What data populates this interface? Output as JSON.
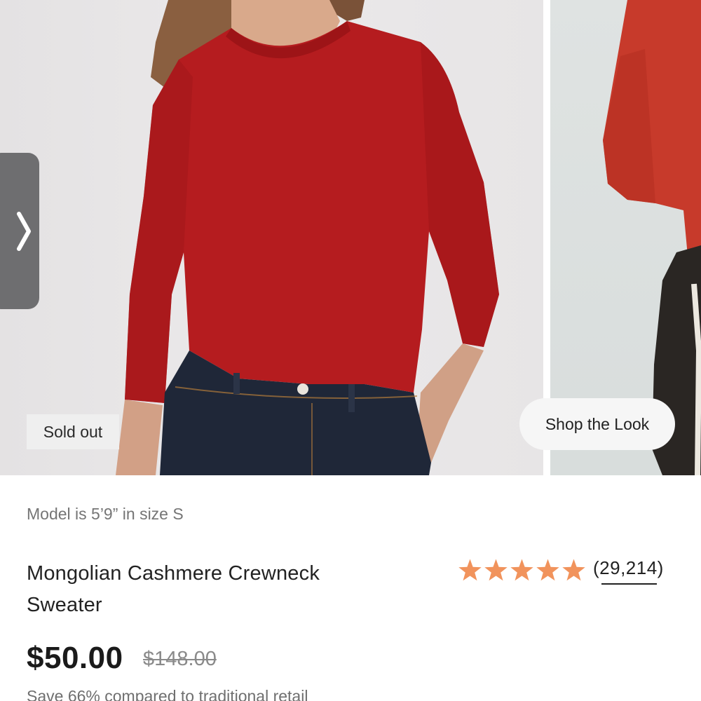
{
  "gallery": {
    "badge": "Sold out",
    "shop_look_label": "Shop the Look",
    "prev_icon": "chevron-right-icon",
    "colors": {
      "sweater": "#b51c1f",
      "side_sweater": "#c73a2b",
      "denim": "#1f2738"
    }
  },
  "product": {
    "model_note": "Model is 5’9” in size S",
    "title": "Mongolian Cashmere Crewneck Sweater",
    "rating": {
      "stars": 5,
      "count_label": "(29,214)",
      "star_color": "#f1935c"
    },
    "price": "$50.00",
    "original_price": "$148.00",
    "savings_text": "Save 66% compared to traditional retail"
  }
}
